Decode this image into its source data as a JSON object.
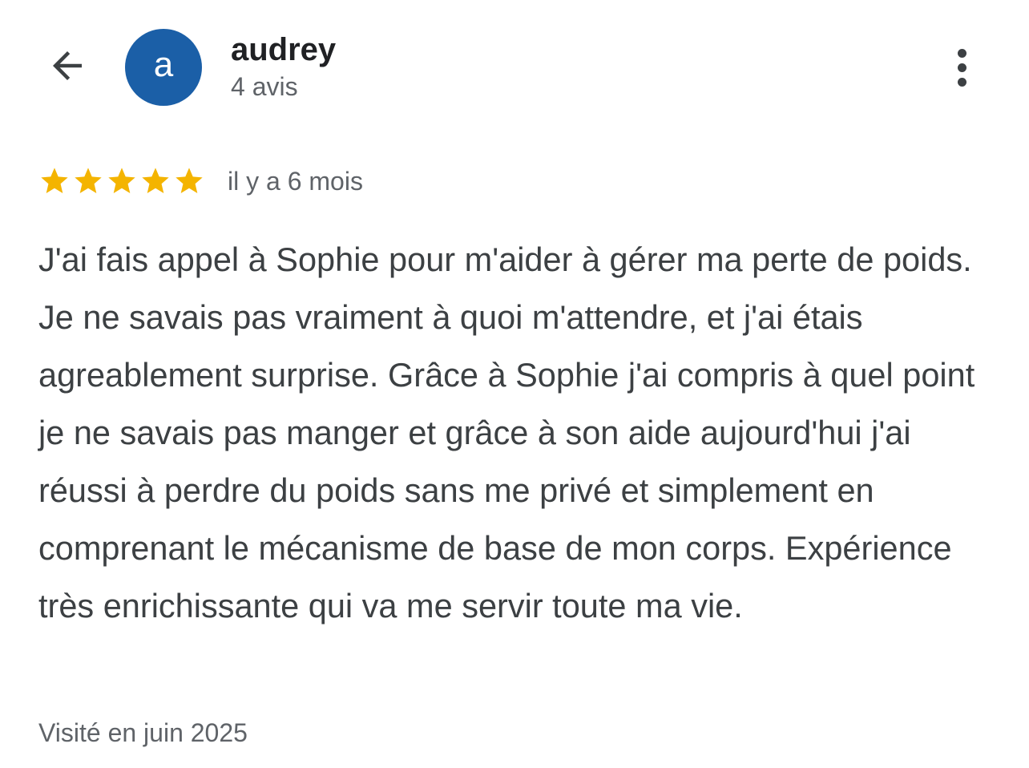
{
  "header": {
    "back_icon": "arrow-left-icon",
    "avatar_letter": "a",
    "avatar_color": "#1b5fa7",
    "user_name": "audrey",
    "review_count": "4 avis",
    "more_icon": "more-vertical-icon"
  },
  "review": {
    "rating": 5,
    "rating_max": 5,
    "star_color": "#f4b400",
    "time": "il y a 6 mois",
    "text": "J'ai fais appel à Sophie pour m'aider à gérer ma perte de poids. Je ne savais pas vraiment à quoi m'attendre, et j'ai étais agreablement surprise. Grâce à Sophie j'ai compris à quel point je ne savais pas manger et grâce à son aide aujourd'hui j'ai réussi à perdre du poids sans me privé et simplement en comprenant le mécanisme de base de mon corps. Expérience très enrichissante qui va me servir toute ma vie.",
    "visited": "Visité en juin 2025"
  }
}
